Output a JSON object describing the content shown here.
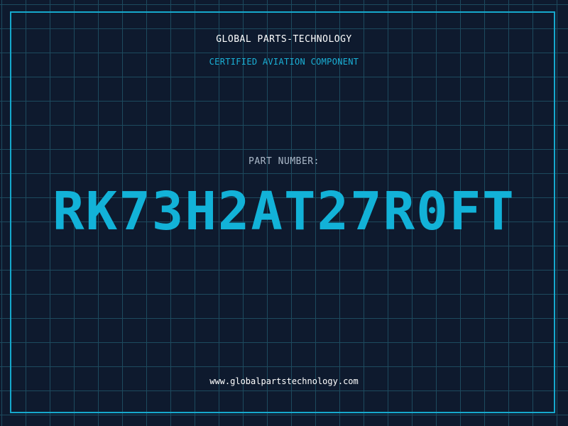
{
  "header": {
    "company": "GLOBAL PARTS-TECHNOLOGY",
    "subtitle": "CERTIFIED AVIATION COMPONENT"
  },
  "part": {
    "label": "PART NUMBER:",
    "number": "RK73H2AT27R0FT"
  },
  "footer": {
    "website": "www.globalpartstechnology.com"
  },
  "colors": {
    "background": "#0e1a2e",
    "grid": "#1d4a5e",
    "accent": "#12b2d8",
    "border": "#16a8cc"
  }
}
